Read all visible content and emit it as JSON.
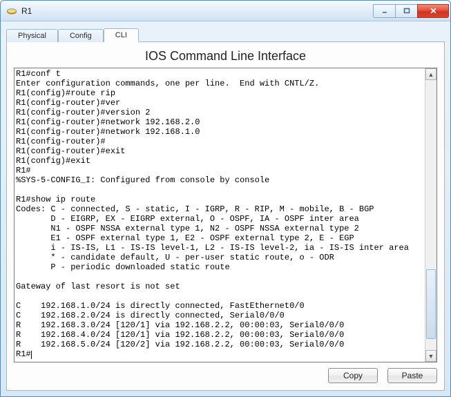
{
  "window": {
    "title": "R1"
  },
  "tabs": [
    {
      "label": "Physical",
      "active": false
    },
    {
      "label": "Config",
      "active": false
    },
    {
      "label": "CLI",
      "active": true
    }
  ],
  "panel": {
    "title": "IOS Command Line Interface"
  },
  "terminal_lines": [
    "R1#conf t",
    "Enter configuration commands, one per line.  End with CNTL/Z.",
    "R1(config)#route rip",
    "R1(config-router)#ver",
    "R1(config-router)#version 2",
    "R1(config-router)#network 192.168.2.0",
    "R1(config-router)#network 192.168.1.0",
    "R1(config-router)#",
    "R1(config-router)#exit",
    "R1(config)#exit",
    "R1#",
    "%SYS-5-CONFIG_I: Configured from console by console",
    "",
    "R1#show ip route",
    "Codes: C - connected, S - static, I - IGRP, R - RIP, M - mobile, B - BGP",
    "       D - EIGRP, EX - EIGRP external, O - OSPF, IA - OSPF inter area",
    "       N1 - OSPF NSSA external type 1, N2 - OSPF NSSA external type 2",
    "       E1 - OSPF external type 1, E2 - OSPF external type 2, E - EGP",
    "       i - IS-IS, L1 - IS-IS level-1, L2 - IS-IS level-2, ia - IS-IS inter area",
    "       * - candidate default, U - per-user static route, o - ODR",
    "       P - periodic downloaded static route",
    "",
    "Gateway of last resort is not set",
    "",
    "C    192.168.1.0/24 is directly connected, FastEthernet0/0",
    "C    192.168.2.0/24 is directly connected, Serial0/0/0",
    "R    192.168.3.0/24 [120/1] via 192.168.2.2, 00:00:03, Serial0/0/0",
    "R    192.168.4.0/24 [120/1] via 192.168.2.2, 00:00:03, Serial0/0/0",
    "R    192.168.5.0/24 [120/2] via 192.168.2.2, 00:00:03, Serial0/0/0",
    "R1#"
  ],
  "scroll": {
    "thumb_top_pct": 70,
    "thumb_height_pct": 26
  },
  "buttons": {
    "copy": "Copy",
    "paste": "Paste"
  }
}
